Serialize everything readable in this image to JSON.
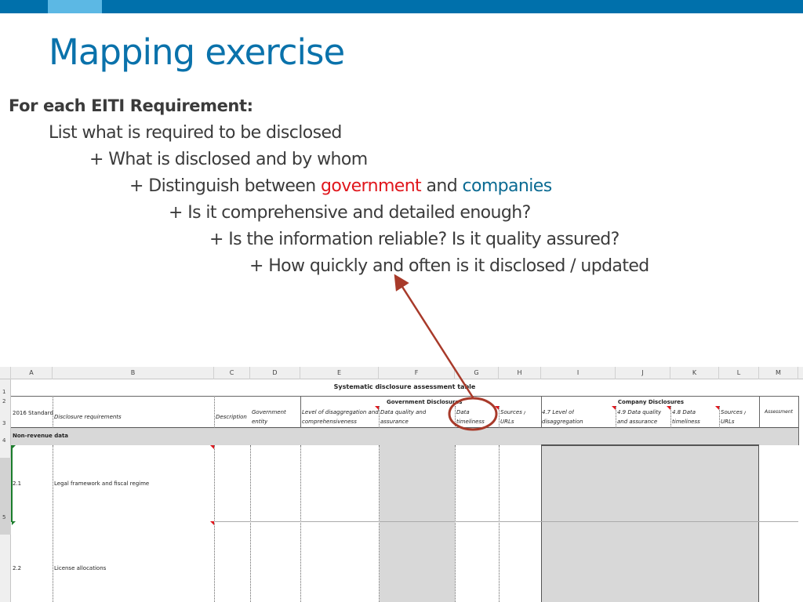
{
  "slide": {
    "title": "Mapping exercise",
    "colors": {
      "brand": "#0070ab",
      "accent": "#5cb8e4",
      "government": "#e0161c",
      "companies": "#0a6a92",
      "annotation": "#a83a2a"
    },
    "bullets": {
      "heading": "For each EITI Requirement:",
      "line1": "List what is required to be disclosed",
      "line2": "+ What is disclosed and by whom",
      "line3_pre": "+ Distinguish between ",
      "line3_gov": "government",
      "line3_mid": " and ",
      "line3_comp": "companies",
      "line4": "+ Is it comprehensive and detailed enough?",
      "line5": "+ Is the information reliable? Is it quality assured?",
      "line6": "+ How quickly and often is it disclosed / updated"
    }
  },
  "spreadsheet": {
    "column_headers": [
      "A",
      "B",
      "C",
      "D",
      "E",
      "F",
      "G",
      "H",
      "I",
      "J",
      "K",
      "L",
      "M"
    ],
    "row_headers": [
      "1",
      "2",
      "3",
      "4",
      "5"
    ],
    "table_title": "Systematic disclosure assessment table",
    "group_government": "Government Disclosures",
    "group_company": "Company Disclosures",
    "headers": {
      "standard": "2016 Standard",
      "requirements": "Disclosure requirements",
      "description": "Description",
      "gov_entity_1": "Government",
      "gov_entity_2": "entity",
      "level_1": "Level of disaggregation and",
      "level_2": "comprehensiveness",
      "quality_1": "Data quality and",
      "quality_2": "assurance",
      "timeliness_1": "Data",
      "timeliness_2": "timeliness",
      "sources_1": "Sources /",
      "sources_2": "URLs",
      "c_level_1": "4.7 Level of",
      "c_level_2": "disaggregation",
      "c_quality_1": "4.9 Data quality",
      "c_quality_2": "and assurance",
      "c_timeliness_1": "4.8 Data",
      "c_timeliness_2": "timeliness",
      "c_sources_1": "Sources /",
      "c_sources_2": "URLs",
      "assessment": "Assessment"
    },
    "section": "Non-revenue data",
    "rows": [
      {
        "id": "2.1",
        "requirement": "Legal framework and fiscal regime"
      },
      {
        "id": "2.2",
        "requirement": "License allocations"
      }
    ]
  },
  "annotation": {
    "type": "arrow-with-circle",
    "target": "Data timeliness",
    "points_to": "+ How quickly and often is it disclosed / updated"
  }
}
